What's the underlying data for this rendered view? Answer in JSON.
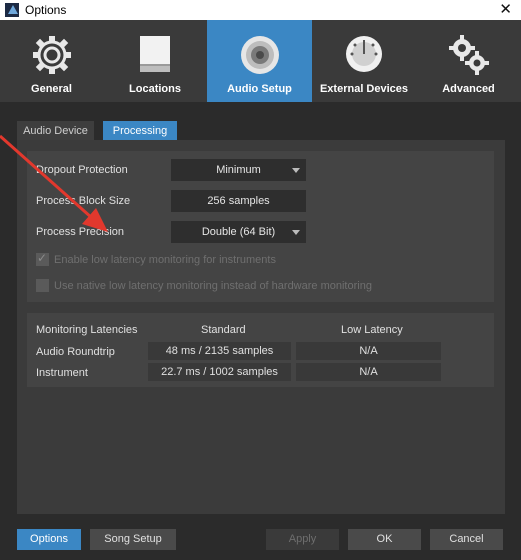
{
  "window": {
    "title": "Options",
    "close_glyph": "✕"
  },
  "tabs": [
    {
      "label": "General",
      "icon": "gear-icon"
    },
    {
      "label": "Locations",
      "icon": "drive-icon"
    },
    {
      "label": "Audio Setup",
      "icon": "speaker-icon"
    },
    {
      "label": "External Devices",
      "icon": "keyboard-dial-icon"
    },
    {
      "label": "Advanced",
      "icon": "gears-icon"
    }
  ],
  "subtabs": {
    "audio_device": "Audio Device",
    "processing": "Processing"
  },
  "processing": {
    "dropout_protection_label": "Dropout Protection",
    "dropout_protection_value": "Minimum",
    "block_size_label": "Process Block Size",
    "block_size_value": "256 samples",
    "precision_label": "Process Precision",
    "precision_value": "Double (64 Bit)",
    "low_latency_label": "Enable low latency monitoring for instruments",
    "native_label": "Use native low latency monitoring instead of hardware monitoring"
  },
  "latencies": {
    "header": "Monitoring Latencies",
    "col_standard": "Standard",
    "col_low": "Low Latency",
    "rows": [
      {
        "label": "Audio Roundtrip",
        "standard": "48 ms / 2135 samples",
        "low": "N/A"
      },
      {
        "label": "Instrument",
        "standard": "22.7 ms / 1002 samples",
        "low": "N/A"
      }
    ]
  },
  "buttons": {
    "options": "Options",
    "song_setup": "Song Setup",
    "apply": "Apply",
    "ok": "OK",
    "cancel": "Cancel"
  },
  "colors": {
    "accent": "#3b87c4",
    "arrow": "#e2382d"
  }
}
